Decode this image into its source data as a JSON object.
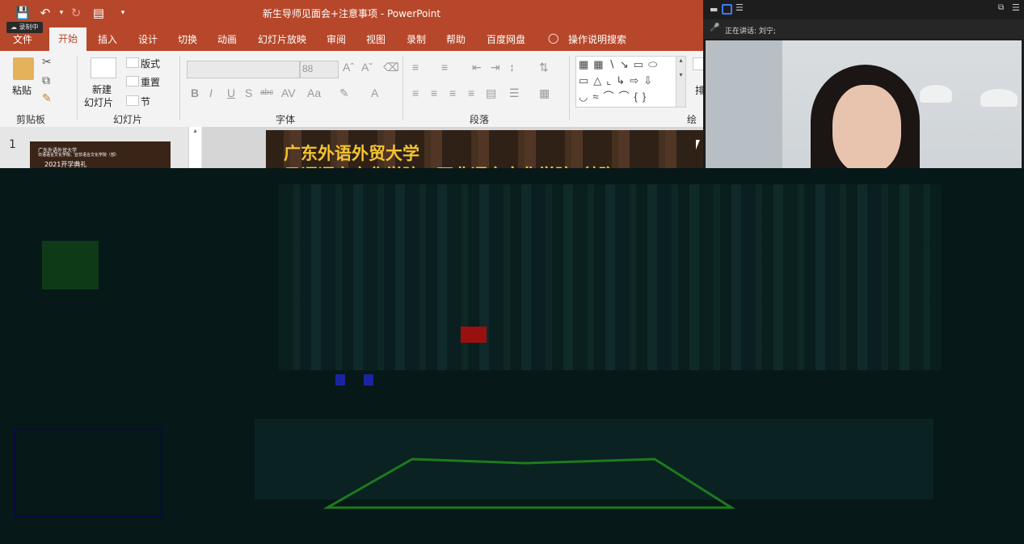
{
  "ppt": {
    "doc_title": "新生导师见面会+注意事项 - PowerPoint",
    "recording_badge": "录制中",
    "tabs": [
      "文件",
      "开始",
      "插入",
      "设计",
      "切换",
      "动画",
      "幻灯片放映",
      "审阅",
      "视图",
      "录制",
      "帮助",
      "百度网盘",
      "操作说明搜索"
    ],
    "ribbon": {
      "clipboard": {
        "paste": "粘贴",
        "label": "剪贴板"
      },
      "slides": {
        "new_slide_1": "新建",
        "new_slide_2": "幻灯片",
        "layout": "版式",
        "reset": "重置",
        "section": "节",
        "label": "幻灯片"
      },
      "font": {
        "size": "88",
        "label": "字体"
      },
      "paragraph": {
        "label": "段落"
      },
      "drawing": {
        "arrange": "排",
        "label": "绘图"
      }
    },
    "slide_number": "1",
    "thumb": {
      "line1": "广东外语外贸大学",
      "line2": "日语语言文化学院、亚非语言文化学院（部）",
      "line3": "2021开学典礼"
    },
    "slide": {
      "title_1": "广东外语外贸大学",
      "title_2": "日语语言文化学院、亚非语言文化学院（部）"
    }
  },
  "video": {
    "speaking_label": "正在讲话: 刘宁;"
  },
  "colors": {
    "ppt_accent": "#b7472a",
    "slide_title": "#f4c430",
    "corrupt_bg": "#071818"
  }
}
